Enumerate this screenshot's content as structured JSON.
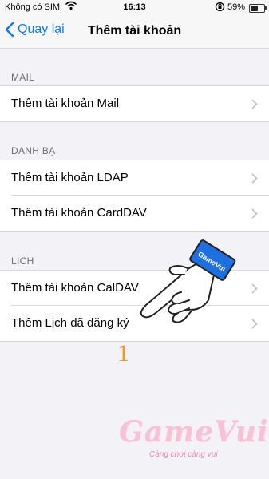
{
  "status_bar": {
    "carrier": "Không có SIM",
    "time": "16:13",
    "battery_percent": "59%",
    "battery_level": 0.59
  },
  "nav": {
    "back_label": "Quay lại",
    "title": "Thêm tài khoản"
  },
  "sections": [
    {
      "header": "MAIL",
      "rows": [
        "Thêm tài khoản Mail"
      ]
    },
    {
      "header": "DANH BẠ",
      "rows": [
        "Thêm tài khoản LDAP",
        "Thêm tài khoản CardDAV"
      ]
    },
    {
      "header": "LỊCH",
      "rows": [
        "Thêm tài khoản CalDAV",
        "Thêm Lịch đã đăng ký"
      ]
    }
  ],
  "overlay": {
    "step_number": "1",
    "cuff_text": "GameVui",
    "logo_text": "GameVui",
    "logo_tagline": "Càng chơi càng vui"
  },
  "colors": {
    "accent": "#0a7aff",
    "background": "#f2f2f7",
    "step_number": "#f7931e"
  }
}
